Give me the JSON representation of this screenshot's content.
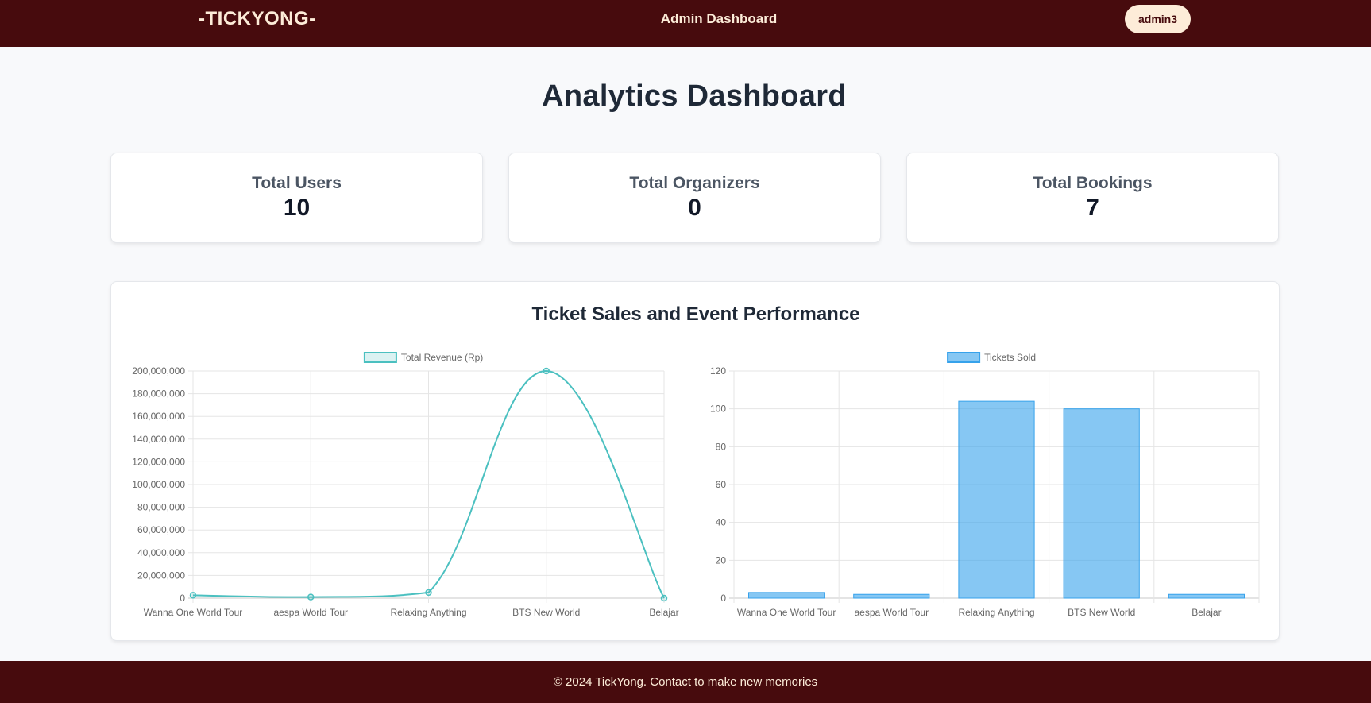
{
  "header": {
    "brand": "-TICKYONG-",
    "title": "Admin Dashboard",
    "user": "admin3"
  },
  "page_title": "Analytics Dashboard",
  "stats": [
    {
      "label": "Total Users",
      "value": "10"
    },
    {
      "label": "Total Organizers",
      "value": "0"
    },
    {
      "label": "Total Bookings",
      "value": "7"
    }
  ],
  "performance": {
    "title": "Ticket Sales and Event Performance"
  },
  "chart_data": [
    {
      "type": "line",
      "categories": [
        "Wanna One World Tour",
        "aespa World Tour",
        "Relaxing Anything",
        "BTS New World",
        "Belajar"
      ],
      "series": [
        {
          "name": "Total Revenue (Rp)",
          "values": [
            2500000,
            1000000,
            5000000,
            200000000,
            0
          ],
          "color": "#4bc0c0"
        }
      ],
      "ylim": [
        0,
        200000000
      ],
      "yticks": [
        "0",
        "20,000,000",
        "40,000,000",
        "60,000,000",
        "80,000,000",
        "100,000,000",
        "120,000,000",
        "140,000,000",
        "160,000,000",
        "180,000,000",
        "200,000,000"
      ],
      "legend": "top",
      "grid": true
    },
    {
      "type": "bar",
      "categories": [
        "Wanna One World Tour",
        "aespa World Tour",
        "Relaxing Anything",
        "BTS New World",
        "Belajar"
      ],
      "series": [
        {
          "name": "Tickets Sold",
          "values": [
            3,
            2,
            104,
            100,
            2
          ],
          "color": "#36a2eb"
        }
      ],
      "ylim": [
        0,
        120
      ],
      "yticks": [
        "0",
        "20",
        "40",
        "60",
        "80",
        "100",
        "120"
      ],
      "legend": "top",
      "grid": true
    }
  ],
  "footer": {
    "text": "© 2024 TickYong. Contact to make new memories"
  }
}
